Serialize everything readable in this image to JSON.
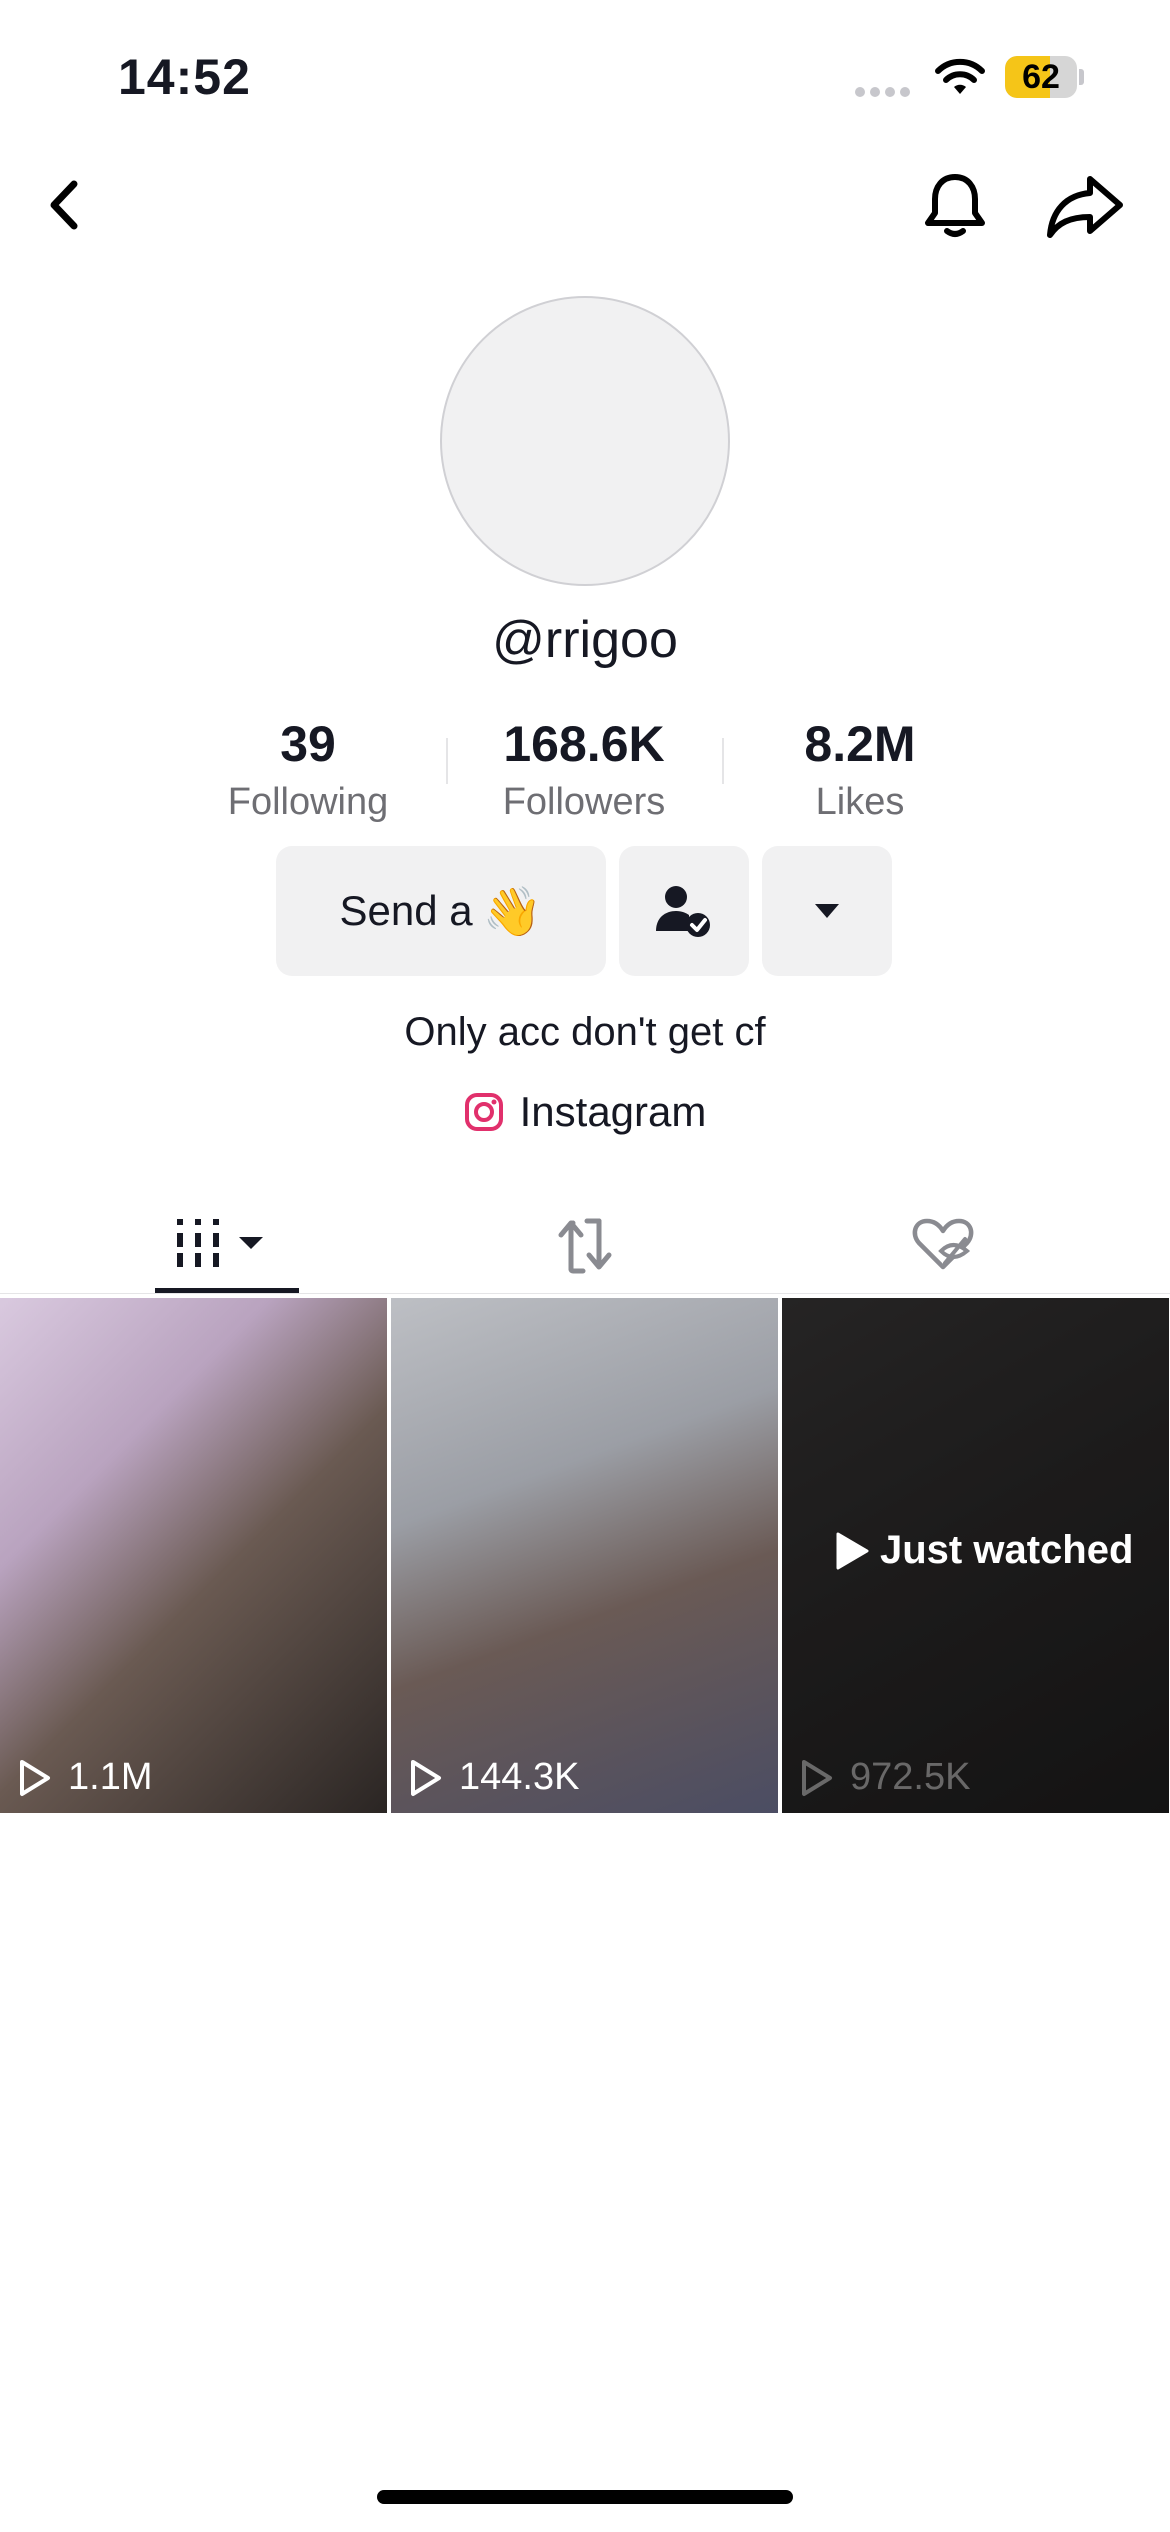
{
  "status_bar": {
    "time": "14:52",
    "battery": "62",
    "battery_level": 0.62
  },
  "profile": {
    "handle": "@rrigoo",
    "stats": [
      {
        "value": "39",
        "label": "Following"
      },
      {
        "value": "168.6K",
        "label": "Followers"
      },
      {
        "value": "8.2M",
        "label": "Likes"
      }
    ],
    "send_button_label": "Send a",
    "send_button_emoji": "👋",
    "bio": "Only acc don't get cf",
    "link_label": "Instagram"
  },
  "icons": {
    "back": "chevron-left-icon",
    "bell": "bell-icon",
    "share": "share-arrow-icon",
    "follow_status": "user-check-icon",
    "more": "caret-down-icon",
    "instagram": "instagram-icon",
    "tab_videos": "grid-icon",
    "tab_reposts": "repost-icon",
    "tab_liked": "hidden-heart-icon"
  },
  "colors": {
    "accent": "#161823",
    "instagram": "#e1306c",
    "battery": "#f5c518"
  },
  "videos": [
    {
      "views": "1.1M"
    },
    {
      "views": "144.3K"
    },
    {
      "views": "972.5K",
      "overlay": "Just watched"
    }
  ]
}
